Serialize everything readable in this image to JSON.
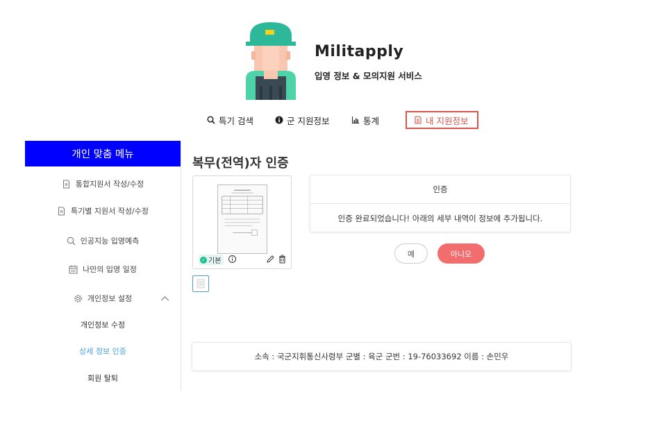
{
  "header": {
    "brand": "Militapply",
    "subtitle": "입영 정보 & 모의지원 서비스"
  },
  "nav": {
    "items": [
      {
        "label": "특기 검색",
        "icon": "search-icon"
      },
      {
        "label": "군 지원정보",
        "icon": "info-circle-icon"
      },
      {
        "label": "통계",
        "icon": "bar-chart-icon"
      },
      {
        "label": "내 지원정보",
        "icon": "document-icon",
        "active": true
      }
    ]
  },
  "sidebar": {
    "header": "개인 맞춤 메뉴",
    "items": [
      {
        "label": "통합지원서 작성/수정",
        "icon": "document-icon"
      },
      {
        "label": "특기별 지원서 작성/수정",
        "icon": "document-icon"
      },
      {
        "label": "인공지능 입영예측",
        "icon": "search-icon"
      },
      {
        "label": "나만의 입영 일정",
        "icon": "calendar-icon"
      },
      {
        "label": "개인정보 설정",
        "icon": "gear-icon",
        "expanded": true
      }
    ],
    "subitems": [
      {
        "label": "개인정보 수정"
      },
      {
        "label": "상세 정보 인증",
        "current": true
      },
      {
        "label": "회원 탈퇴"
      }
    ]
  },
  "main": {
    "title": "복무(전역)자 인증",
    "card": {
      "badge": "기본"
    },
    "dialog": {
      "title": "인증",
      "message": "인증 완료되었습니다! 아래의 세부 내역이 정보에 추가됩니다."
    },
    "buttons": {
      "yes": "예",
      "no": "아니오"
    },
    "info": "소속 : 국군지휘통신사령부 군별 : 육군 군번 : 19-76033692 이름 : 손민우"
  },
  "colors": {
    "sidebar_header": "#0000ff",
    "active_nav": "#d9534f",
    "no_button": "#f26d6d",
    "current_subitem": "#4a9fe0"
  }
}
